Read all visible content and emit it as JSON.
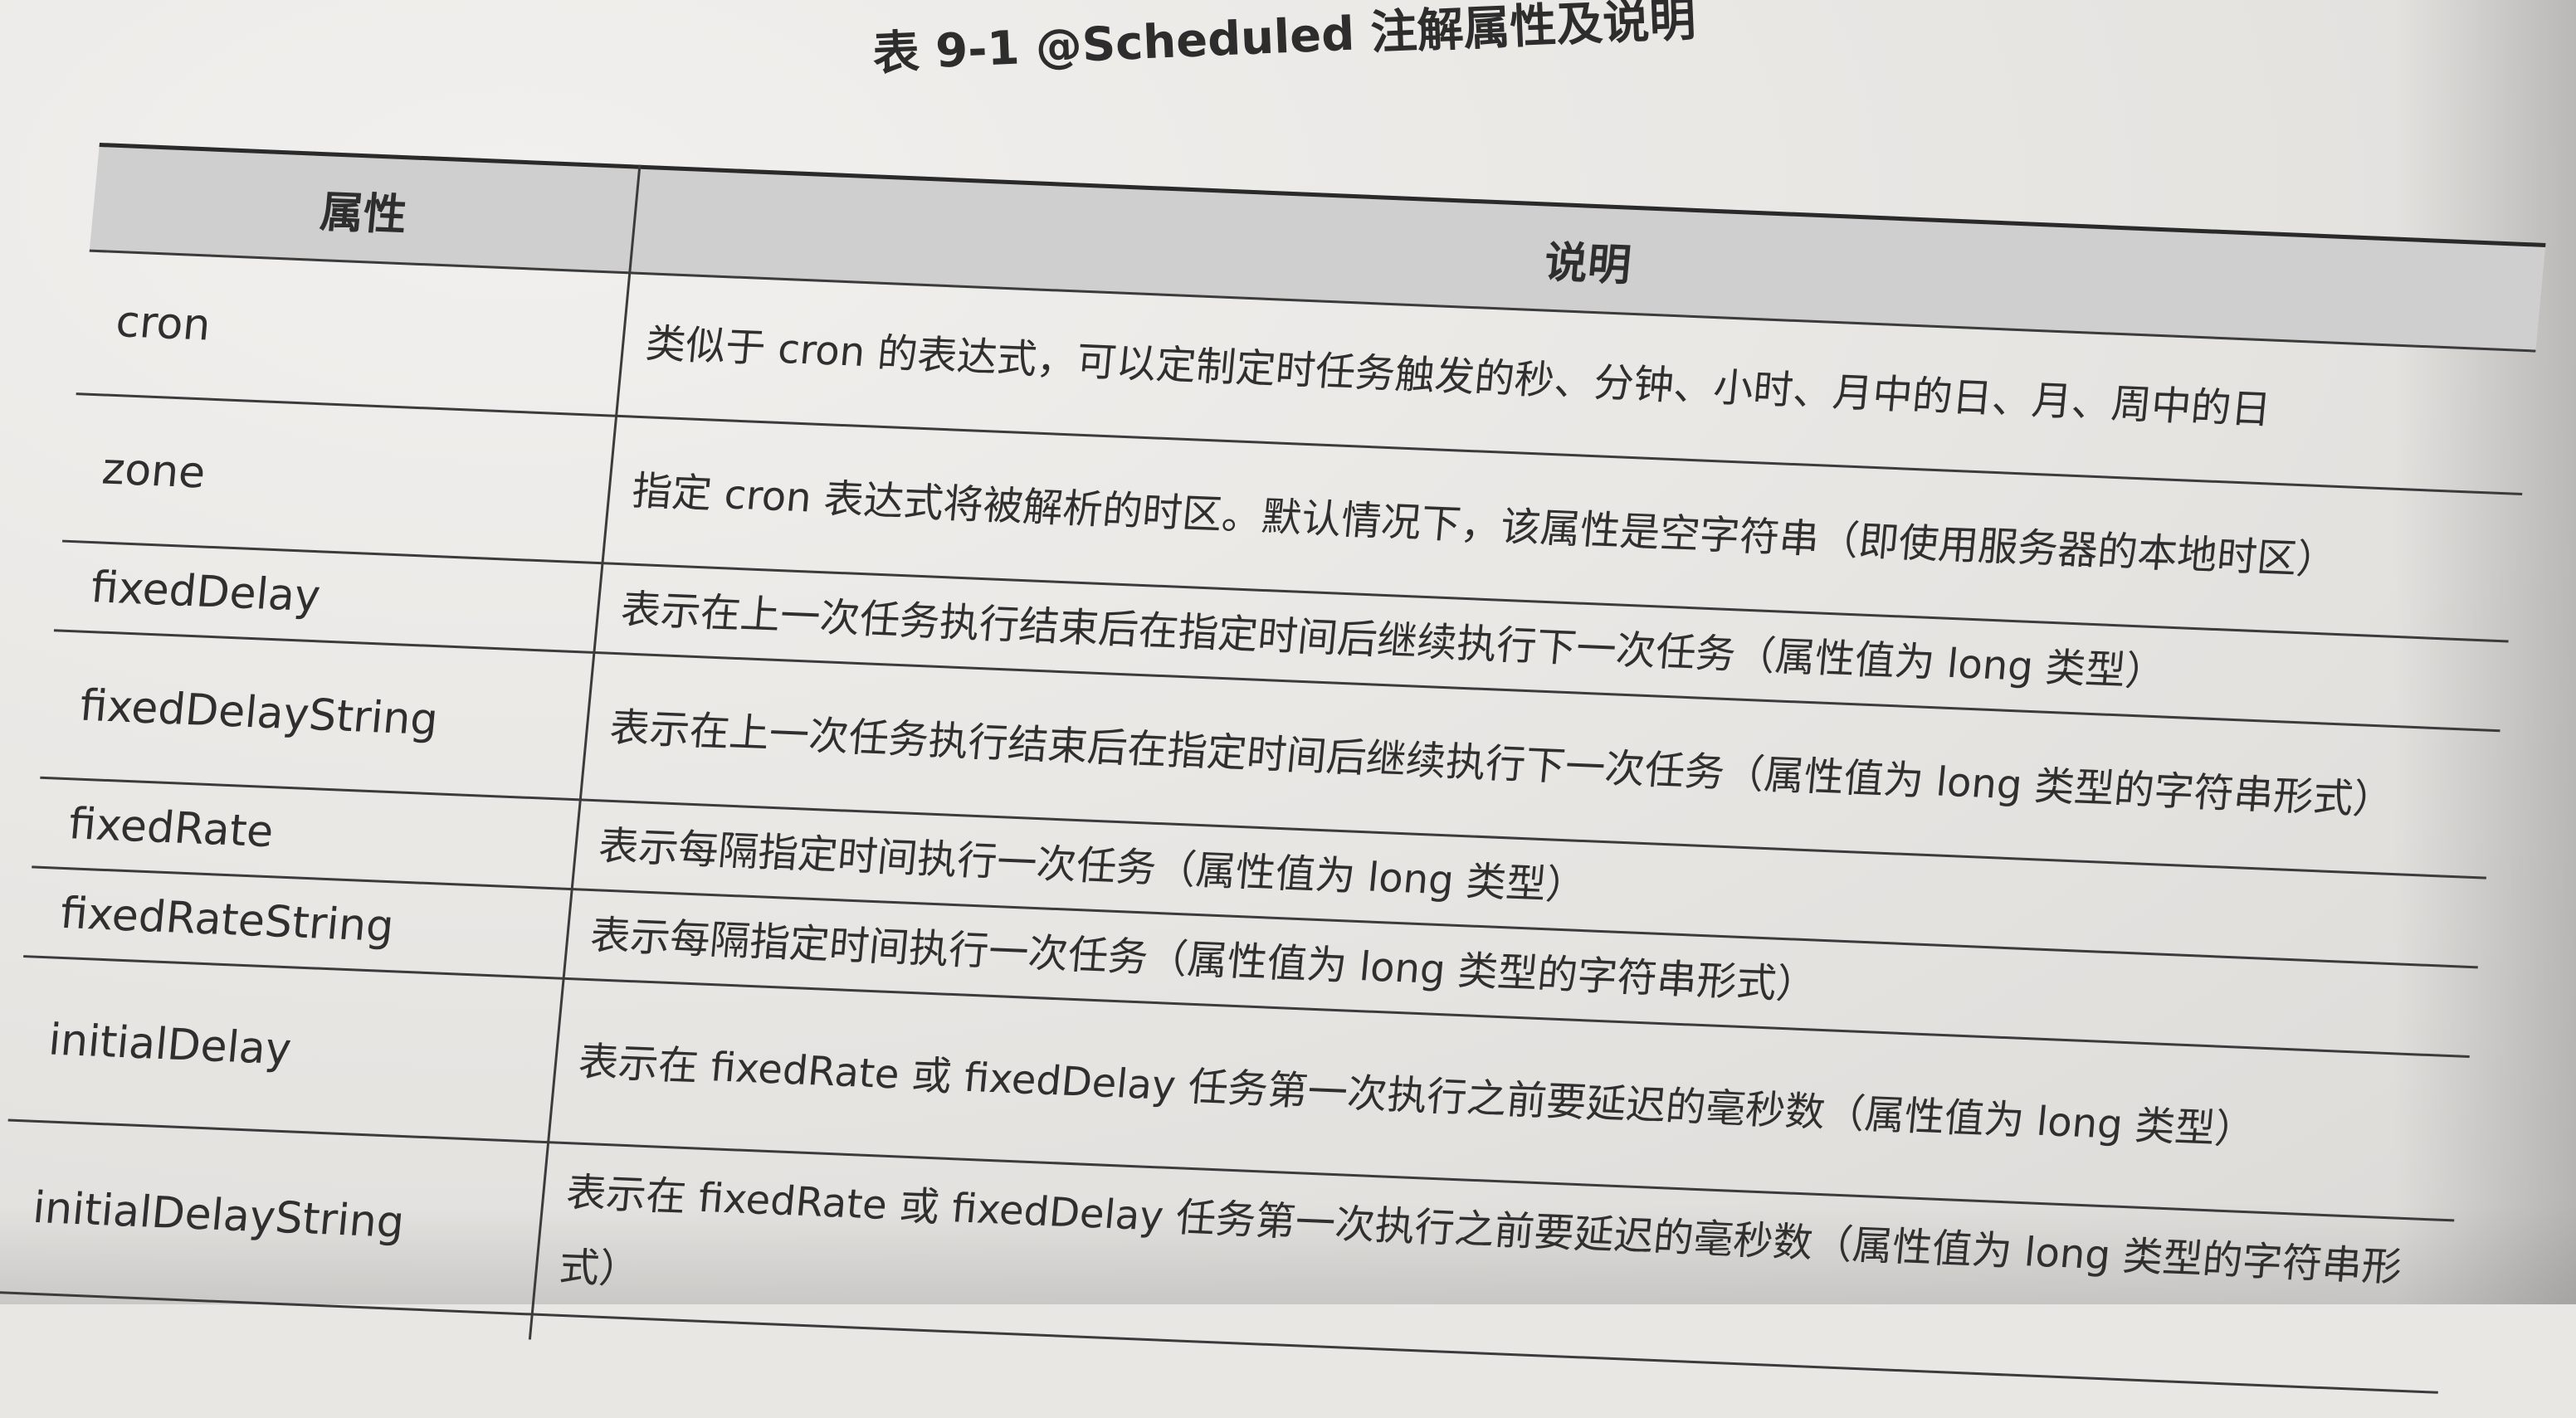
{
  "table": {
    "caption": "表 9-1 @Scheduled 注解属性及说明",
    "header": {
      "attribute": "属性",
      "description": "说明"
    },
    "rows": [
      {
        "attribute": "cron",
        "description": "类似于 cron 的表达式，可以定制定时任务触发的秒、分钟、小时、月中的日、月、周中的日"
      },
      {
        "attribute": "zone",
        "description": "指定 cron 表达式将被解析的时区。默认情况下，该属性是空字符串（即使用服务器的本地时区）"
      },
      {
        "attribute": "fixedDelay",
        "description": "表示在上一次任务执行结束后在指定时间后继续执行下一次任务（属性值为 long 类型）"
      },
      {
        "attribute": "fixedDelayString",
        "description": "表示在上一次任务执行结束后在指定时间后继续执行下一次任务（属性值为 long 类型的字符串形式）"
      },
      {
        "attribute": "fixedRate",
        "description": "表示每隔指定时间执行一次任务（属性值为 long 类型）"
      },
      {
        "attribute": "fixedRateString",
        "description": "表示每隔指定时间执行一次任务（属性值为 long 类型的字符串形式）"
      },
      {
        "attribute": "initialDelay",
        "description": "表示在 fixedRate 或 fixedDelay 任务第一次执行之前要延迟的毫秒数（属性值为 long 类型）"
      },
      {
        "attribute": "initialDelayString",
        "description": "表示在 fixedRate 或 fixedDelay 任务第一次执行之前要延迟的毫秒数（属性值为 long 类型的字符串形式）"
      }
    ]
  }
}
